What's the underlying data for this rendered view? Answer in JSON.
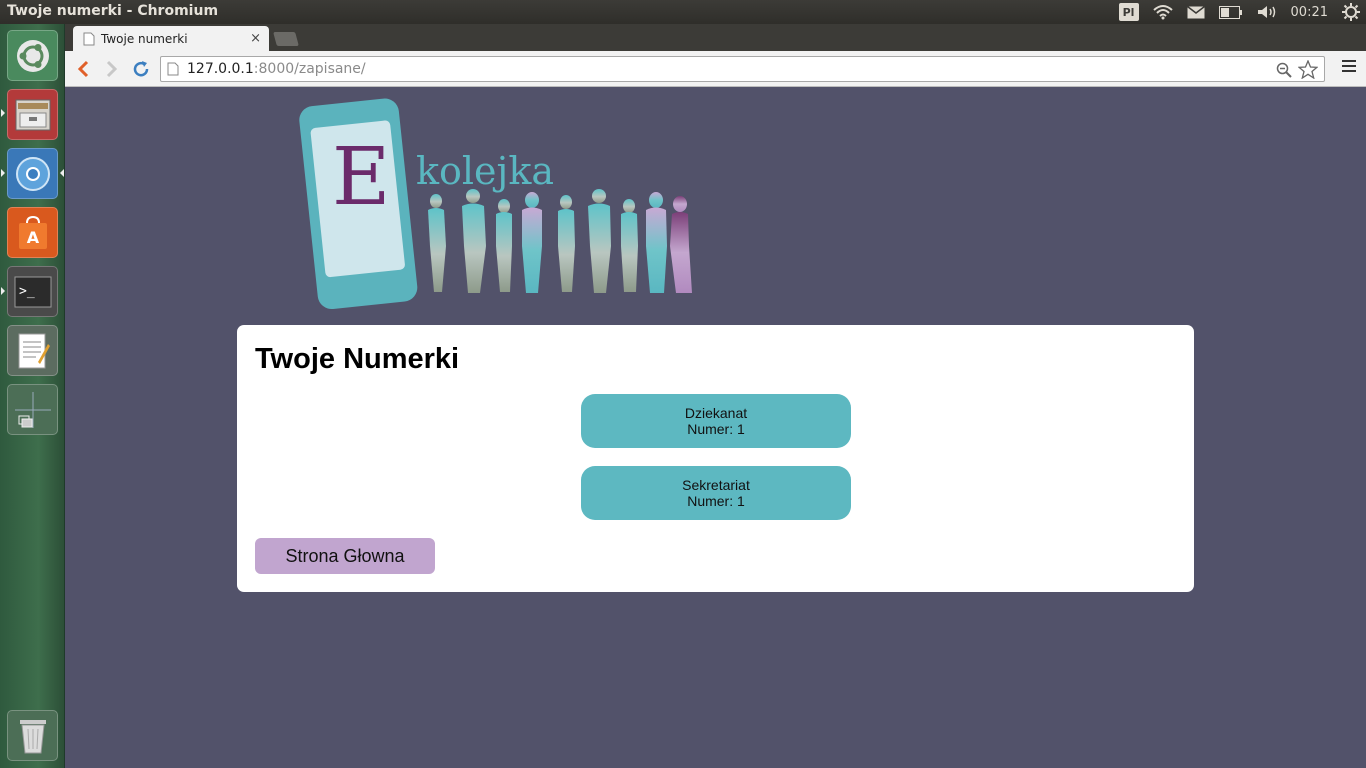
{
  "top_panel": {
    "window_title": "Twoje numerki - Chromium",
    "keyboard_layout": "Pl",
    "clock": "00:21"
  },
  "browser": {
    "tab_title": "Twoje numerki",
    "tab_close": "×",
    "url_host": "127.0.0.1",
    "url_rest": ":8000/zapisane/"
  },
  "logo": {
    "letter": "E",
    "word": "kolejka"
  },
  "page": {
    "title": "Twoje Numerki",
    "tickets": [
      {
        "office": "Dziekanat",
        "number": "Numer: 1"
      },
      {
        "office": "Sekretariat",
        "number": "Numer: 1"
      }
    ],
    "home_button": "Strona Głowna"
  },
  "colors": {
    "page_background": "#52526a",
    "ticket": "#5db8c1",
    "home_button": "#c1a5cf",
    "logo_letter": "#6b2b6b"
  }
}
